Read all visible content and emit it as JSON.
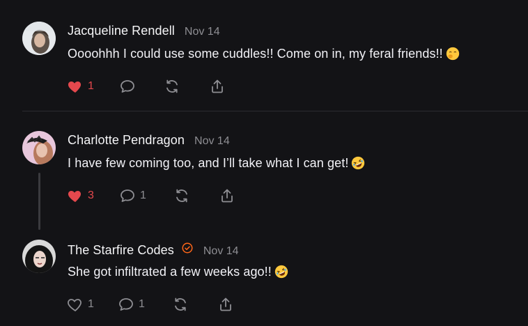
{
  "colors": {
    "background": "#131316",
    "liked": "#e5484d",
    "muted": "#8e8e93",
    "verified": "#ff6719"
  },
  "comments": [
    {
      "author": "Jacqueline Rendell",
      "date": "Nov 14",
      "text": "Oooohhh I could use some cuddles!! Come on in, my feral friends!!",
      "emoji": "face-with-hand-over-mouth",
      "likes": "1",
      "liked": true,
      "replies": "",
      "verified": false
    },
    {
      "author": "Charlotte Pendragon",
      "date": "Nov 14",
      "text": "I have few coming too, and I’ll take what I can get!",
      "emoji": "rolling-on-the-floor-laughing",
      "likes": "3",
      "liked": true,
      "replies": "1",
      "verified": false
    },
    {
      "author": "The Starfire Codes",
      "date": "Nov 14",
      "text": "She got infiltrated a few weeks ago!!",
      "emoji": "rolling-on-the-floor-laughing",
      "likes": "1",
      "liked": false,
      "replies": "1",
      "verified": true
    }
  ]
}
